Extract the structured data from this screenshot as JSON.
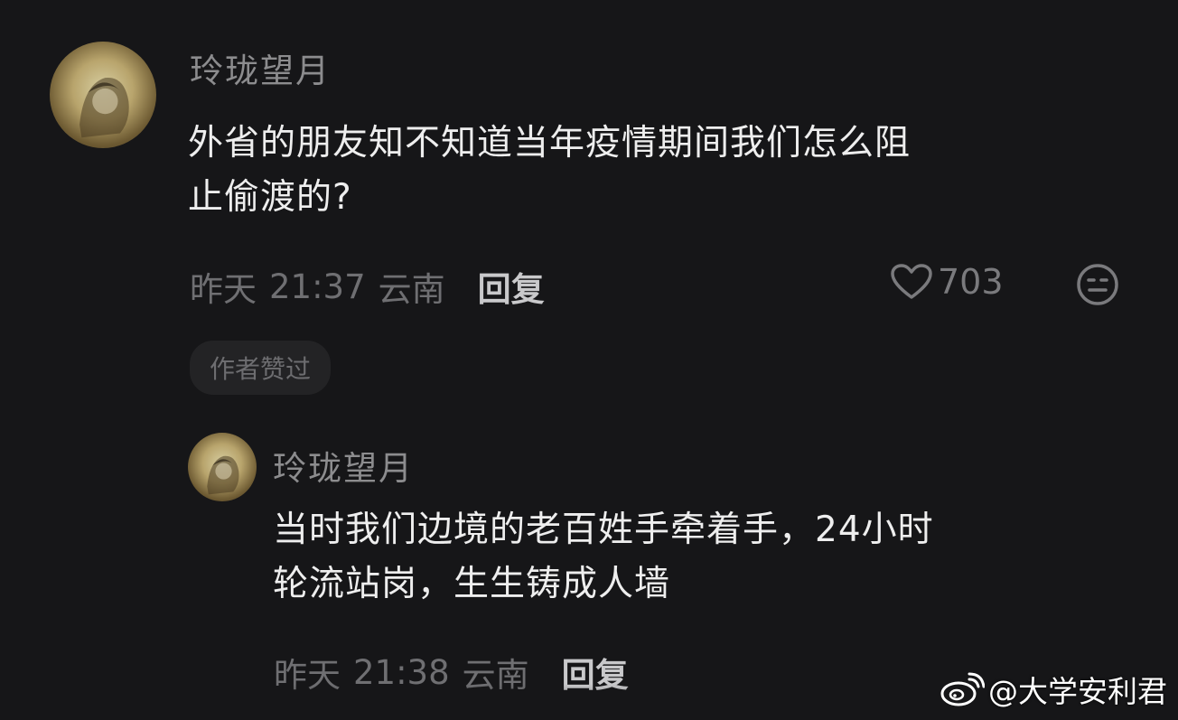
{
  "comments": [
    {
      "username": "玲珑望月",
      "text_lines": [
        "外省的朋友知不知道当年疫情期间我们怎么阻",
        "止偷渡的?"
      ],
      "date": "昨天",
      "time": "21:37",
      "location": "云南",
      "reply_label": "回复",
      "likes": "703",
      "author_badge": "作者赞过"
    },
    {
      "username": "玲珑望月",
      "text_lines": [
        "当时我们边境的老百姓手牵着手，24小时",
        "轮流站岗，生生铸成人墙"
      ],
      "date": "昨天",
      "time": "21:38",
      "location": "云南",
      "reply_label": "回复"
    }
  ],
  "watermark": {
    "icon": "weibo-logo-icon",
    "text": "@大学安利君"
  },
  "colors": {
    "background": "#161618",
    "username": "#8c8c8e",
    "text": "#eeeeee",
    "meta": "#6f6f72",
    "reply": "#c9c9cb"
  }
}
